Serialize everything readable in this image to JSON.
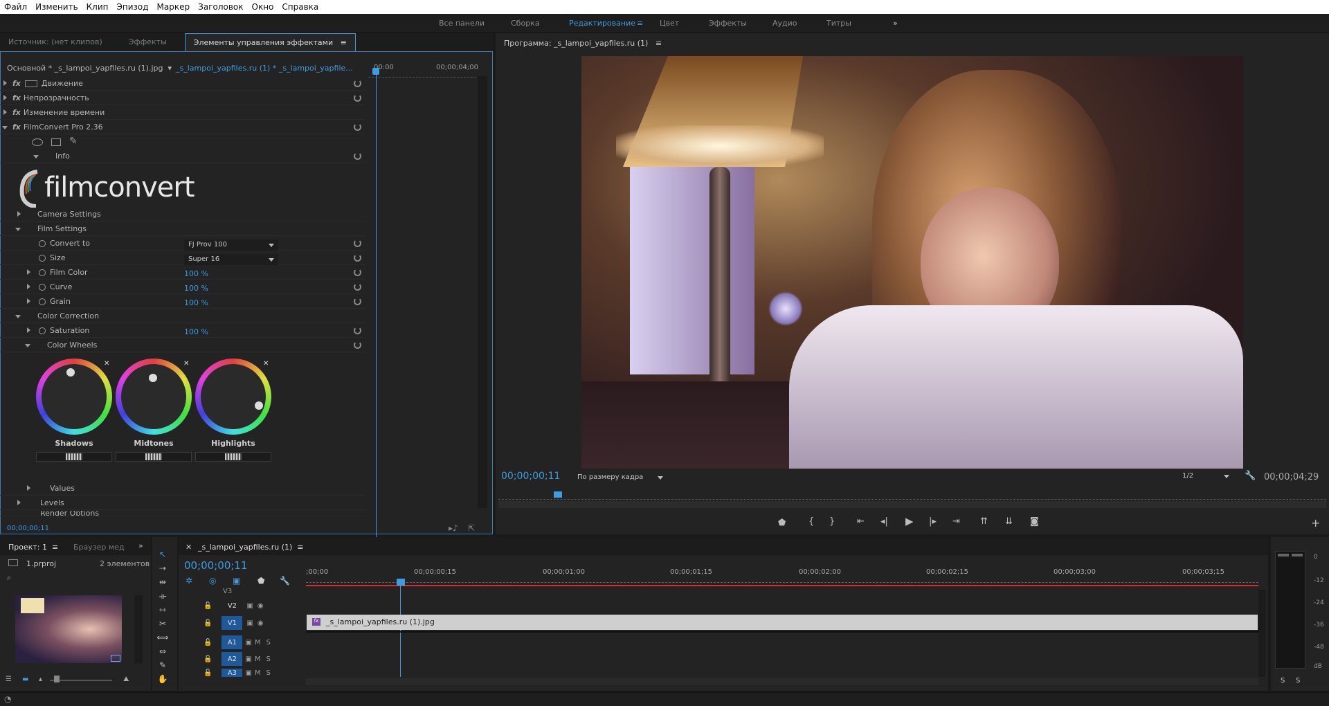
{
  "menu": [
    "Файл",
    "Изменить",
    "Клип",
    "Эпизод",
    "Маркер",
    "Заголовок",
    "Окно",
    "Справка"
  ],
  "workspaces": {
    "all": "Все панели",
    "assembly": "Сборка",
    "editing": "Редактирование",
    "color": "Цвет",
    "effects": "Эффекты",
    "audio": "Аудио",
    "titles": "Титры",
    "more": "»"
  },
  "effect_panel": {
    "tabs": {
      "source": "Источник: (нет клипов)",
      "effects": "Эффекты",
      "controls": "Элементы управления эффектами"
    },
    "master": "Основной * _s_lampoi_yapfiles.ru (1).jpg",
    "sequence": "_s_lampoi_yapfiles.ru (1) * _s_lampoi_yapfile...",
    "mini_tc_start": "00:00",
    "mini_tc_end": "00;00;04;00",
    "rows": {
      "motion": "Движение",
      "opacity": "Непрозрачность",
      "timeremap": "Изменение времени",
      "filmconvert": "FilmConvert Pro 2.36",
      "info": "Info",
      "camera": "Camera Settings",
      "film_settings": "Film Settings",
      "convert_to": "Convert to",
      "size": "Size",
      "film_color": "Film Color",
      "curve": "Curve",
      "grain": "Grain",
      "color_correction": "Color Correction",
      "saturation": "Saturation",
      "color_wheels": "Color Wheels",
      "values": "Values",
      "levels": "Levels",
      "render": "Render Options"
    },
    "logo": "filmconvert",
    "convert_value": "FJ Prov 100",
    "size_value": "Super 16",
    "film_color_value": "100 %",
    "curve_value": "100 %",
    "grain_value": "100 %",
    "saturation_value": "100 %",
    "wheels": {
      "shadows": "Shadows",
      "midtones": "Midtones",
      "highlights": "Highlights"
    },
    "timecode": "00;00;00;11",
    "fx": "fx"
  },
  "program": {
    "title": "Программа: _s_lampoi_yapfiles.ru (1)",
    "timecode": "00;00;00;11",
    "fit": "По размеру кадра",
    "resolution": "1/2",
    "duration": "00;00;04;29"
  },
  "project": {
    "tab": "Проект: 1",
    "browser": "Браузер мед",
    "file": "1.prproj",
    "count": "2 элементов"
  },
  "timeline": {
    "seq": "_s_lampoi_yapfiles.ru (1)",
    "timecode": "00;00;00;11",
    "ruler": [
      ";00;00",
      "00;00;00;15",
      "00;00;01;00",
      "00;00;01;15",
      "00;00;02;00",
      "00;00;02;15",
      "00;00;03;00",
      "00;00;03;15"
    ],
    "tracks": {
      "v3": "V3",
      "v2": "V2",
      "v1": "V1",
      "a1": "A1",
      "a2": "A2",
      "a3": "A3"
    },
    "m": "M",
    "s": "S",
    "clip": "_s_lampoi_yapfiles.ru (1).jpg"
  },
  "meter": {
    "labels": [
      "0",
      "-12",
      "-24",
      "-36",
      "-48",
      "dB"
    ],
    "s1": "S",
    "s2": "S"
  },
  "colors": {
    "accent": "#3d9de0",
    "red": "#d03030"
  }
}
